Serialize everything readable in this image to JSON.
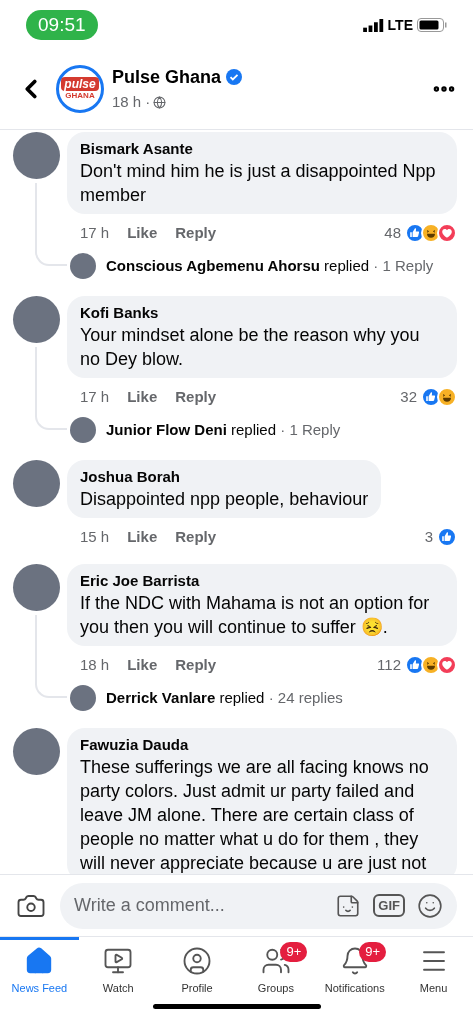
{
  "status_bar": {
    "time": "09:51",
    "network": "LTE"
  },
  "header": {
    "logo_top": "pulse",
    "logo_bottom": "GHANA",
    "page_name": "Pulse Ghana",
    "verified": true,
    "time": "18 h ·"
  },
  "comments": [
    {
      "author": "Bismark Asante",
      "text": "Don't mind him he is just a disappointed Npp  member",
      "time": "17 h",
      "like": "Like",
      "reply": "Reply",
      "count": "48",
      "reactions": [
        {
          "kind": "like"
        },
        {
          "kind": "haha"
        },
        {
          "kind": "love"
        }
      ],
      "replies": {
        "author": "Conscious Agbemenu Ahorsu",
        "verb": "replied",
        "count": "· 1 Reply"
      }
    },
    {
      "author": "Kofi Banks",
      "text": "Your mindset alone be the reason why you no Dey blow.",
      "time": "17 h",
      "like": "Like",
      "reply": "Reply",
      "count": "32",
      "reactions": [
        {
          "kind": "like"
        },
        {
          "kind": "haha"
        }
      ],
      "replies": {
        "author": "Junior Flow Deni",
        "verb": "replied",
        "count": "· 1 Reply"
      }
    },
    {
      "author": "Joshua Borah",
      "text": "Disappointed npp people, behaviour",
      "time": "15 h",
      "like": "Like",
      "reply": "Reply",
      "count": "3",
      "reactions": [
        {
          "kind": "like"
        }
      ]
    },
    {
      "author": "Eric Joe Barrista",
      "text": "If the NDC with Mahama is not an option for you then you will continue to suffer 😣.",
      "time": "18 h",
      "like": "Like",
      "reply": "Reply",
      "count": "112",
      "reactions": [
        {
          "kind": "like"
        },
        {
          "kind": "haha"
        },
        {
          "kind": "love"
        }
      ],
      "replies": {
        "author": "Derrick Vanlare",
        "verb": "replied",
        "count": "· 24 replies"
      }
    },
    {
      "author": "Fawuzia Dauda",
      "text": "These  sufferings we are all facing knows no party colors. Just admit ur  party failed and leave JM alone. There are certain class of people no matter what u do for them , they will never appreciate because u are just not"
    }
  ],
  "composer": {
    "placeholder": "Write a comment...",
    "gif": "GIF"
  },
  "nav": [
    {
      "kind": "home",
      "label": "News Feed",
      "selected": true
    },
    {
      "kind": "watch",
      "label": "Watch",
      "selected": false
    },
    {
      "kind": "profile",
      "label": "Profile",
      "selected": false
    },
    {
      "kind": "groups",
      "label": "Groups",
      "selected": false,
      "badge": "9+"
    },
    {
      "kind": "bell",
      "label": "Notifications",
      "selected": false,
      "badge": "9+"
    },
    {
      "kind": "menu",
      "label": "Menu",
      "selected": false
    }
  ]
}
